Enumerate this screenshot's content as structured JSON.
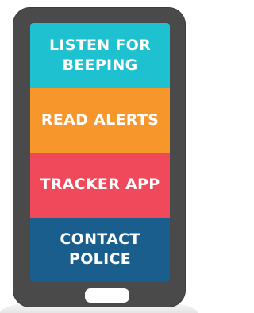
{
  "phone": {
    "body_color": "#4a4a4a",
    "home_button_color": "#ffffff"
  },
  "tiles": [
    {
      "label": "LISTEN FOR BEEPING",
      "color": "#1ec1cf"
    },
    {
      "label": "READ ALERTS",
      "color": "#f7962b"
    },
    {
      "label": "TRACKER APP",
      "color": "#f0495b"
    },
    {
      "label": "CONTACT POLICE",
      "color": "#195e8c"
    }
  ]
}
